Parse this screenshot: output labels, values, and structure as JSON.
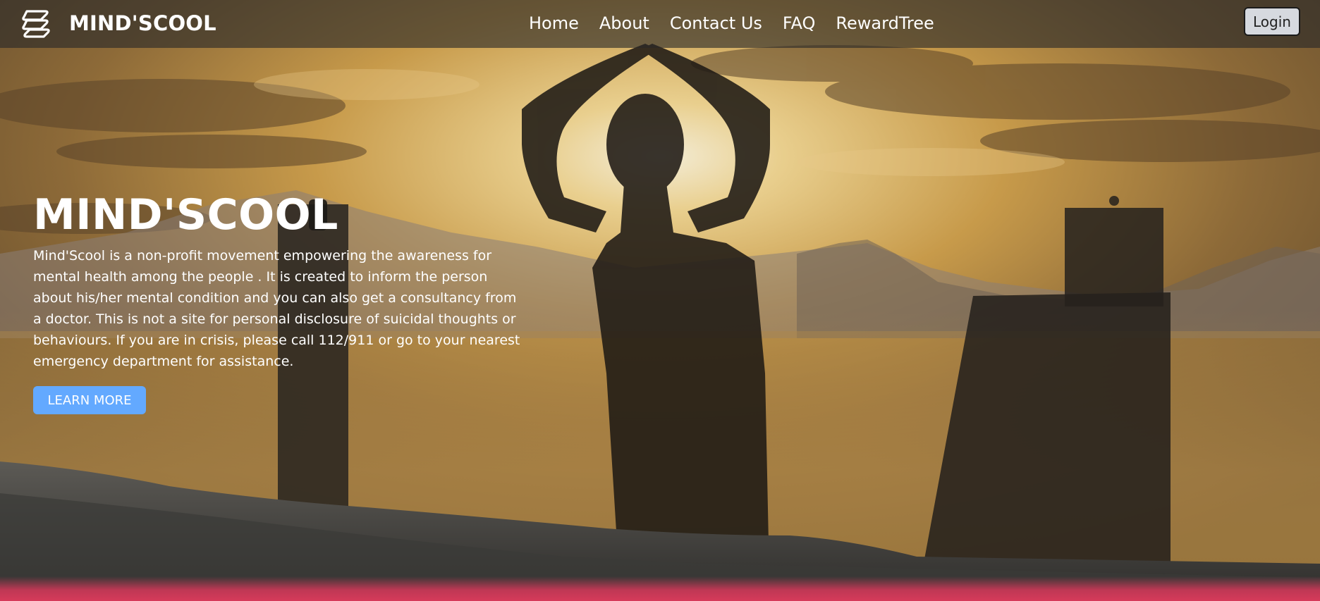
{
  "brand": {
    "name": "MIND'SCOOL",
    "logo_icon": "stacked-wave-logo-icon"
  },
  "nav": {
    "links": [
      {
        "label": "Home"
      },
      {
        "label": "About"
      },
      {
        "label": "Contact Us"
      },
      {
        "label": "FAQ"
      },
      {
        "label": "RewardTree"
      }
    ],
    "login_label": "Login"
  },
  "hero": {
    "title": "MIND'SCOOL",
    "description": "Mind'Scool is a non-profit movement empowering the awareness for mental health among the people . It is created to inform the person about his/her mental condition and you can also get a consultancy from a doctor. This is not a site for personal disclosure of suicidal thoughts or behaviours. If you are in crisis, please call 112/911 or go to your nearest emergency department for assistance.",
    "cta_label": "LEARN MORE",
    "background": "sunset-yoga-silhouette-image"
  },
  "colors": {
    "navbar": "#282828",
    "cta": "#63a9ff",
    "accent_strip": "#d63a5a",
    "login_bg": "#d6d9df"
  }
}
